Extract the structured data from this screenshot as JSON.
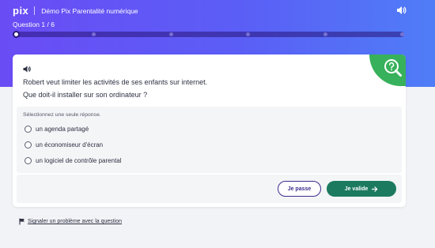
{
  "header": {
    "logo": "pix",
    "title": "Démo Pix Parentalité numérique",
    "question_counter": "Question 1 / 6",
    "progress": {
      "current": 1,
      "total": 6
    }
  },
  "question": {
    "lines": [
      "Robert veut limiter les activités de ses enfants sur internet.",
      "Que doit-il installer sur son ordinateur ?"
    ],
    "competence_icon": "question-mark-icon"
  },
  "answers": {
    "instruction": "Sélectionnez une seule réponse.",
    "options": [
      {
        "label": "un agenda partagé",
        "selected": false
      },
      {
        "label": "un économiseur d'écran",
        "selected": false
      },
      {
        "label": "un logiciel de contrôle parental",
        "selected": false
      }
    ]
  },
  "actions": {
    "skip_label": "Je passe",
    "validate_label": "Je valide"
  },
  "footer": {
    "report_label": "Signaler un problème avec la question"
  },
  "colors": {
    "banner_start": "#6a4cf5",
    "banner_end": "#4f7df7",
    "corner_green": "#37b15b",
    "validate_green": "#1c7a5f",
    "skip_purple": "#3d2c8d"
  }
}
